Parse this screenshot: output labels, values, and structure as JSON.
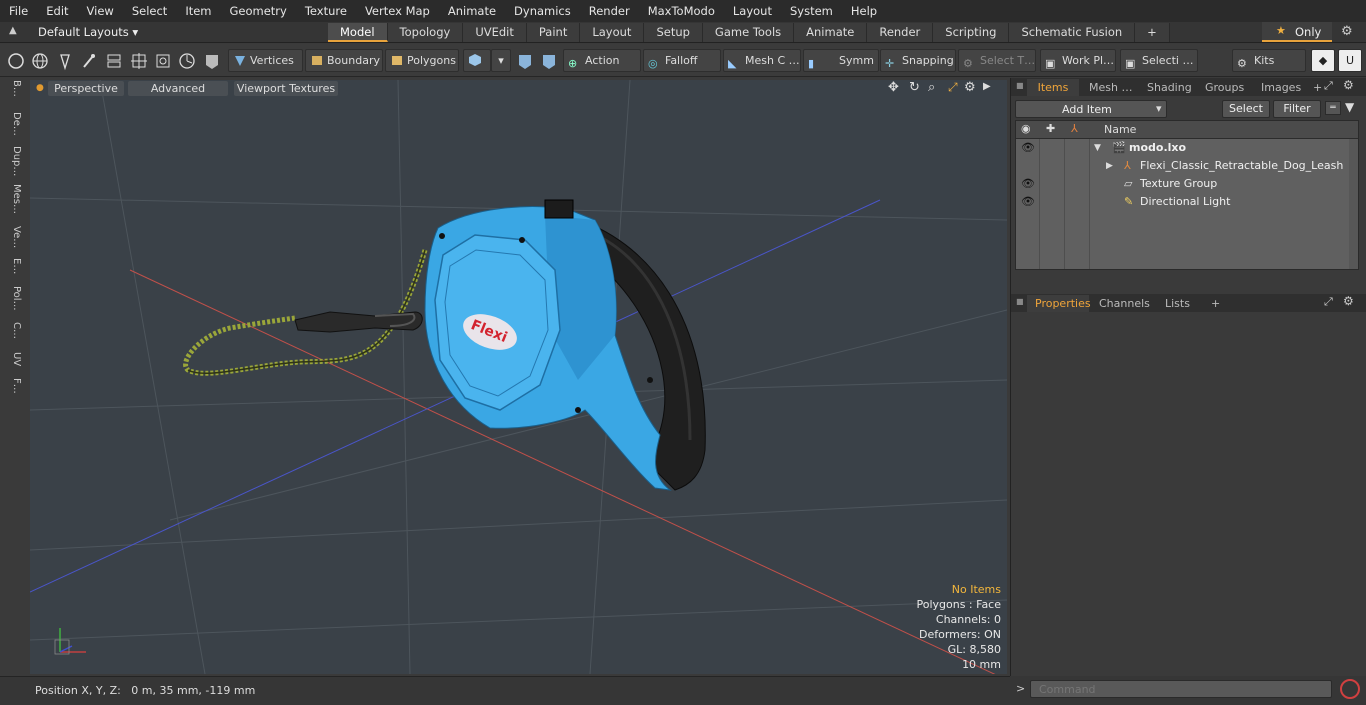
{
  "menu": [
    "File",
    "Edit",
    "View",
    "Select",
    "Item",
    "Geometry",
    "Texture",
    "Vertex Map",
    "Animate",
    "Dynamics",
    "Render",
    "MaxToModo",
    "Layout",
    "System",
    "Help"
  ],
  "layout": {
    "selector": "Default Layouts ▾",
    "only_label": "Only"
  },
  "tabs": [
    {
      "label": "Model",
      "active": true
    },
    {
      "label": "Topology"
    },
    {
      "label": "UVEdit"
    },
    {
      "label": "Paint"
    },
    {
      "label": "Layout"
    },
    {
      "label": "Setup"
    },
    {
      "label": "Game Tools"
    },
    {
      "label": "Animate"
    },
    {
      "label": "Render"
    },
    {
      "label": "Scripting"
    },
    {
      "label": "Schematic Fusion"
    },
    {
      "label": "+"
    }
  ],
  "toolbar": {
    "vertices": "Vertices",
    "boundary": "Boundary",
    "polygons": "Polygons",
    "action": "Action",
    "falloff": "Falloff",
    "mesh": "Mesh C …",
    "symm": "Symm …",
    "snapping": "Snapping",
    "select_t": "Select T…",
    "work_pl": "Work Pl…",
    "selecti": "Selecti …",
    "kits": "Kits"
  },
  "left_tabs": [
    "B…",
    "De…",
    "Dup…",
    "Mes…",
    "Ve…",
    "E…",
    "Pol…",
    "C…",
    "UV",
    "F…"
  ],
  "viewport": {
    "perspective": "Perspective",
    "advanced": "Advanced",
    "textures": "Viewport Textures",
    "stats": {
      "no_items": "No Items",
      "polygons": "Polygons : Face",
      "channels": "Channels: 0",
      "deformers": "Deformers: ON",
      "gl": "GL: 8,580",
      "scale": "10 mm"
    }
  },
  "status": {
    "position": "Position X, Y, Z:   0 m, 35 mm, -119 mm"
  },
  "items_panel": {
    "tabs": [
      "Items",
      "Mesh …",
      "Shading",
      "Groups",
      "Images",
      "+"
    ],
    "add_item": "Add Item",
    "select": "Select",
    "filter": "Filter",
    "col_name": "Name",
    "rows": [
      {
        "name": "modo.lxo"
      },
      {
        "name": "Flexi_Classic_Retractable_Dog_Leash"
      },
      {
        "name": "Texture Group"
      },
      {
        "name": "Directional Light"
      }
    ]
  },
  "props_panel": {
    "tabs": [
      "Properties",
      "Channels",
      "Lists",
      "+"
    ]
  },
  "command": {
    "placeholder": "Command"
  },
  "logo_text": "Flexi",
  "colors": {
    "accent": "#f0a53a",
    "leash_blue": "#3aa7e4",
    "handle_black": "#1e1e1e",
    "cord_green": "#9aa63a"
  }
}
